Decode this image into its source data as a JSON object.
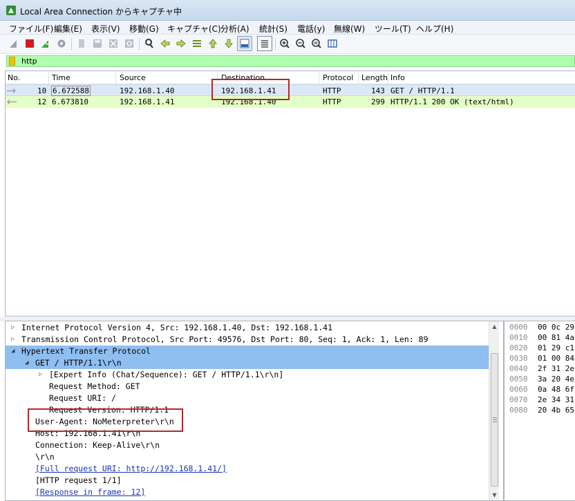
{
  "window": {
    "title": "Local Area Connection からキャプチャ中"
  },
  "menu": [
    "ファイル(F)",
    "編集(E)",
    "表示(V)",
    "移動(G)",
    "キャプチャ(C)",
    "分析(A)",
    "統計(S)",
    "電話(y)",
    "無線(W)",
    "ツール(T)",
    "ヘルプ(H)"
  ],
  "toolbar": {
    "icons": [
      "shark-fin-start-icon",
      "stop-square-icon",
      "restart-shark-icon",
      "capture-options-gear-icon",
      "open-file-icon",
      "save-file-icon",
      "close-file-icon",
      "reload-file-icon",
      "find-packet-icon",
      "go-back-arrow-icon",
      "go-forward-arrow-icon",
      "go-to-packet-icon",
      "first-packet-icon",
      "last-packet-icon",
      "autoscroll-icon",
      "colorize-icon",
      "zoom-in-icon",
      "zoom-out-icon",
      "zoom-reset-icon",
      "resize-columns-icon"
    ]
  },
  "filter": {
    "value": "http"
  },
  "packet_list": {
    "columns": [
      "No.",
      "Time",
      "Source",
      "Destination",
      "Protocol",
      "Length",
      "Info"
    ],
    "rows": [
      {
        "no": "10",
        "time": "6.672588",
        "source": "192.168.1.40",
        "destination": "192.168.1.41",
        "protocol": "HTTP",
        "length": "143",
        "info": "GET / HTTP/1.1"
      },
      {
        "no": "12",
        "time": "6.673810",
        "source": "192.168.1.41",
        "destination": "192.168.1.40",
        "protocol": "HTTP",
        "length": "299",
        "info": "HTTP/1.1 200 OK  (text/html)"
      }
    ]
  },
  "details": {
    "lines": [
      "Internet Protocol Version 4, Src: 192.168.1.40, Dst: 192.168.1.41",
      "Transmission Control Protocol, Src Port: 49576, Dst Port: 80, Seq: 1, Ack: 1, Len: 89",
      "Hypertext Transfer Protocol",
      "GET / HTTP/1.1\\r\\n",
      "[Expert Info (Chat/Sequence): GET / HTTP/1.1\\r\\n]",
      "Request Method: GET",
      "Request URI: /",
      "Request Version: HTTP/1.1",
      "User-Agent: NoMeterpreter\\r\\n",
      "Host: 192.168.1.41\\r\\n",
      "Connection: Keep-Alive\\r\\n",
      "\\r\\n",
      "[Full request URI: http://192.168.1.41/]",
      "[HTTP request 1/1]",
      "[Response in frame: 12]"
    ]
  },
  "hex": {
    "offsets": [
      "0000",
      "0010",
      "0020",
      "0030",
      "0040",
      "0050",
      "0060",
      "0070",
      "0080"
    ],
    "bytes": [
      "00 0c 29",
      "00 81 4a",
      "01 29 c1",
      "01 00 84",
      "2f 31 2e",
      "3a 20 4e",
      "0a 48 6f",
      "2e 34 31",
      "20 4b 65"
    ]
  },
  "colors": {
    "filter_ok": "#afffaf",
    "selected_row": "#dde8f6",
    "http_response_row": "#e4ffc7",
    "tree_selected": "#8fbef0",
    "annotation_red": "#b3272d"
  }
}
